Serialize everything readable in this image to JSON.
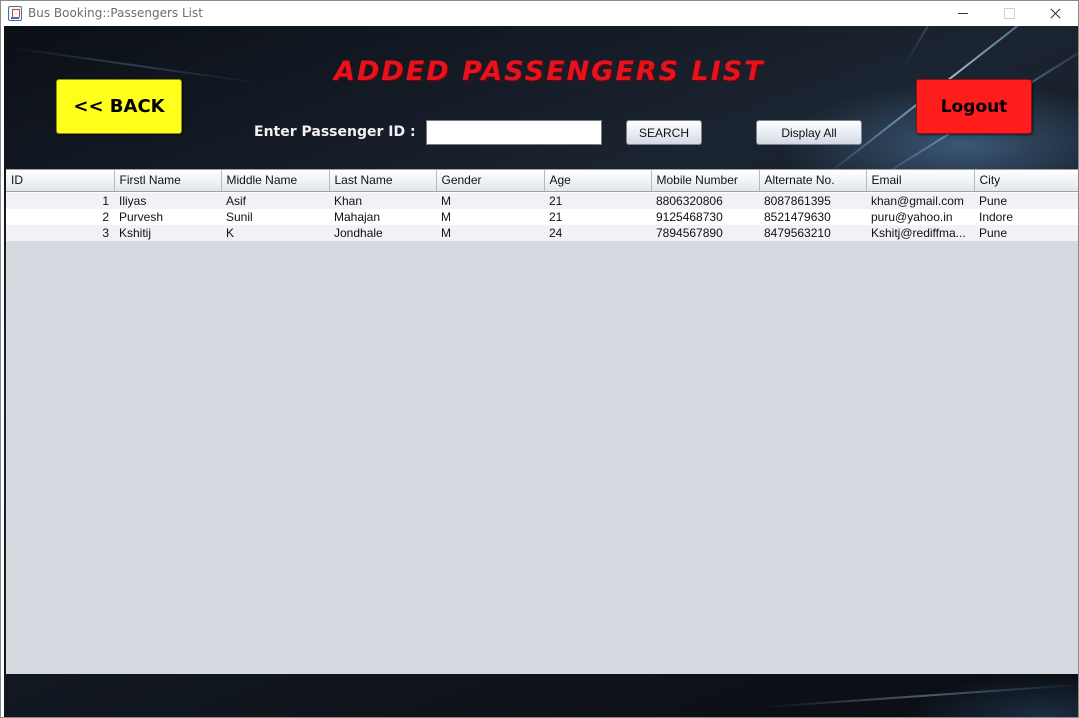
{
  "window": {
    "title": "Bus Booking::Passengers List"
  },
  "header": {
    "heading": "ADDED PASSENGERS LIST",
    "back_label": "<< BACK",
    "logout_label": "Logout"
  },
  "search": {
    "label": "Enter Passenger  ID :",
    "value": "",
    "search_label": "SEARCH",
    "display_all_label": "Display All"
  },
  "table": {
    "columns": [
      "ID",
      "Firstl Name",
      "Middle Name",
      "Last Name",
      "Gender",
      "Age",
      "Mobile Number",
      "Alternate No.",
      "Email",
      "City"
    ],
    "rows": [
      [
        "1",
        "Iliyas",
        "Asif",
        "Khan",
        "M",
        "21",
        "8806320806",
        "8087861395",
        "khan@gmail.com",
        "Pune"
      ],
      [
        "2",
        "Purvesh",
        "Sunil",
        "Mahajan",
        "M",
        "21",
        "9125468730",
        "8521479630",
        "puru@yahoo.in",
        "Indore"
      ],
      [
        "3",
        "Kshitij",
        "K",
        "Jondhale",
        "M",
        "24",
        "7894567890",
        "8479563210",
        "Kshitj@rediffma...",
        "Pune"
      ]
    ]
  },
  "colors": {
    "heading": "#e8121d",
    "back_button": "#ffff1c",
    "logout_button": "#ff1c1c",
    "table_background": "#d6d9e0"
  }
}
